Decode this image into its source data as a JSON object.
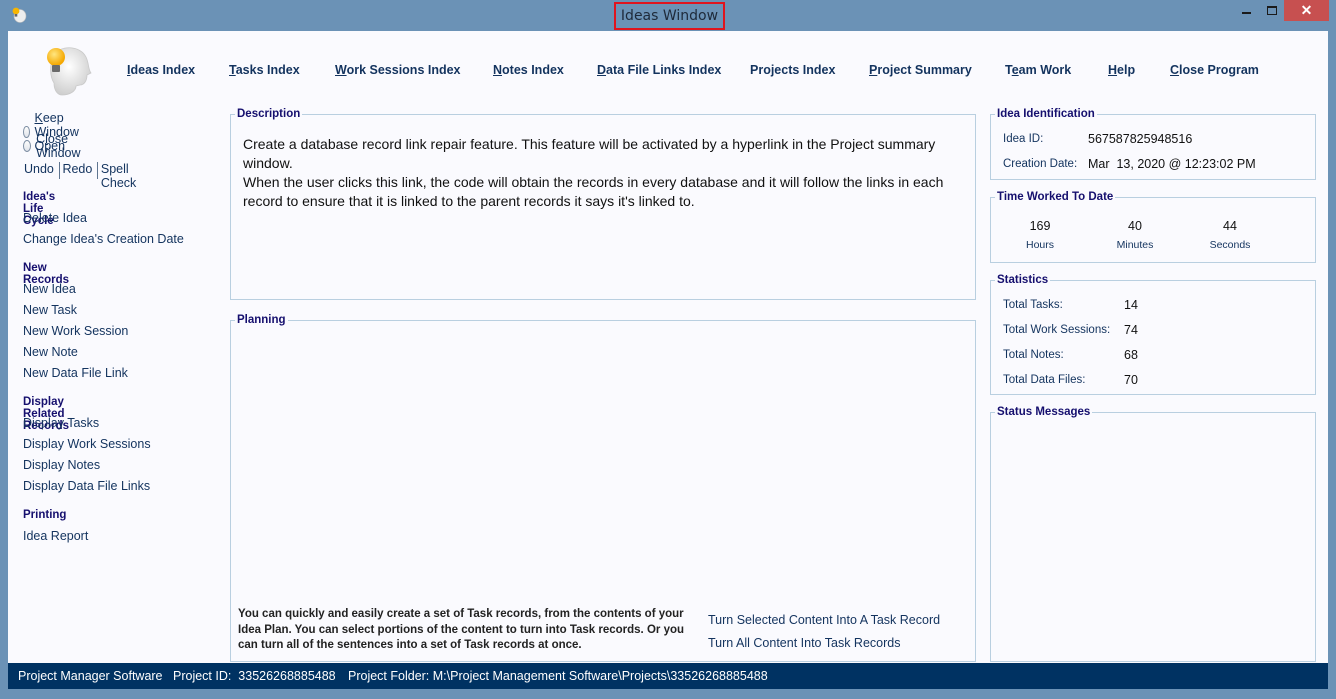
{
  "window": {
    "title": "Ideas Window",
    "controls": {
      "minimize_icon": "minimize-icon",
      "maximize_icon": "maximize-icon",
      "close_label": "✕"
    }
  },
  "topnav": [
    {
      "label": "Ideas Index",
      "accel": "I",
      "rest": "deas Index"
    },
    {
      "label": "Tasks Index",
      "accel": "T",
      "rest": "asks Index"
    },
    {
      "label": "Work Sessions Index",
      "accel": "W",
      "rest": "ork Sessions Index"
    },
    {
      "label": "Notes Index",
      "accel": "N",
      "rest": "otes Index"
    },
    {
      "label": "Data File Links Index",
      "accel": "D",
      "rest": "ata File Links Index"
    },
    {
      "label": "Projects Index",
      "accel": "",
      "rest": "Projects Index"
    },
    {
      "label": "Project Summary",
      "accel": "P",
      "rest": "roject Summary"
    },
    {
      "label": "Team Work",
      "accel_pre": "T",
      "accel": "e",
      "rest": "am Work"
    },
    {
      "label": "Help",
      "accel": "H",
      "rest": "elp"
    },
    {
      "label": "Close Program",
      "accel": "C",
      "rest": "lose Program"
    }
  ],
  "sidebar": {
    "radios": [
      {
        "label": "Keep Window Open",
        "accel": "K",
        "rest": "eep Window Open",
        "checked": false
      },
      {
        "label": "Close Window",
        "pre": "C",
        "accel": "l",
        "rest": "ose Window",
        "checked": false
      }
    ],
    "edit_actions": [
      "Undo",
      "Redo",
      "Spell Check"
    ],
    "sections": [
      {
        "heading": "Idea's Life Cycle",
        "items": [
          "Delete Idea",
          "Change Idea's Creation Date"
        ]
      },
      {
        "heading": "New Records",
        "items": [
          "New Idea",
          "New Task",
          "New Work Session",
          "New Note",
          "New Data File Link"
        ]
      },
      {
        "heading": "Display Related Records",
        "items": [
          "Display Tasks",
          "Display Work Sessions",
          "Display Notes",
          "Display Data File Links"
        ]
      },
      {
        "heading": "Printing",
        "items": [
          "Idea Report"
        ]
      }
    ]
  },
  "description": {
    "label": "Description",
    "text": "Create a database record link repair feature. This feature will be activated by a hyperlink in the Project summary window.\nWhen the user clicks this link, the code will obtain the records in every database and it will follow the links in each record to ensure that it is linked to the parent records it says it's linked to."
  },
  "planning": {
    "label": "Planning",
    "content": "",
    "help_text": "You can quickly and easily create a set of Task records, from the contents of your Idea Plan. You can select portions of the content to turn into Task records. Or you can turn all of the sentences into a set of Task records at once.",
    "links": [
      "Turn Selected Content Into A Task Record",
      "Turn All Content Into Task Records"
    ]
  },
  "identification": {
    "label": "Idea Identification",
    "idea_id_label": "Idea ID:",
    "idea_id": "567587825948516",
    "creation_date_label": "Creation Date:",
    "creation_date": "Mar  13, 2020 @ 12:23:02 PM"
  },
  "time_worked": {
    "label": "Time Worked To Date",
    "hours": "169",
    "hours_label": "Hours",
    "minutes": "40",
    "minutes_label": "Minutes",
    "seconds": "44",
    "seconds_label": "Seconds"
  },
  "statistics": {
    "label": "Statistics",
    "rows": [
      {
        "label": "Total Tasks:",
        "value": "14"
      },
      {
        "label": "Total Work Sessions:",
        "value": "74"
      },
      {
        "label": "Total Notes:",
        "value": "68"
      },
      {
        "label": "Total Data Files:",
        "value": "70"
      }
    ]
  },
  "status_messages": {
    "label": "Status Messages",
    "text": ""
  },
  "statusbar": {
    "app_name": "Project Manager Software",
    "project_id": "Project ID:  33526268885488",
    "project_folder": "Project Folder: M:\\Project Management Software\\Projects\\33526268885488"
  },
  "colors": {
    "frame": "#6b92b6",
    "client_bg": "#fafafe",
    "link": "#13335e",
    "heading": "#150f6e",
    "statusbar_bg": "#003262",
    "close_button": "#c75050",
    "title_highlight": "#e0141e"
  }
}
